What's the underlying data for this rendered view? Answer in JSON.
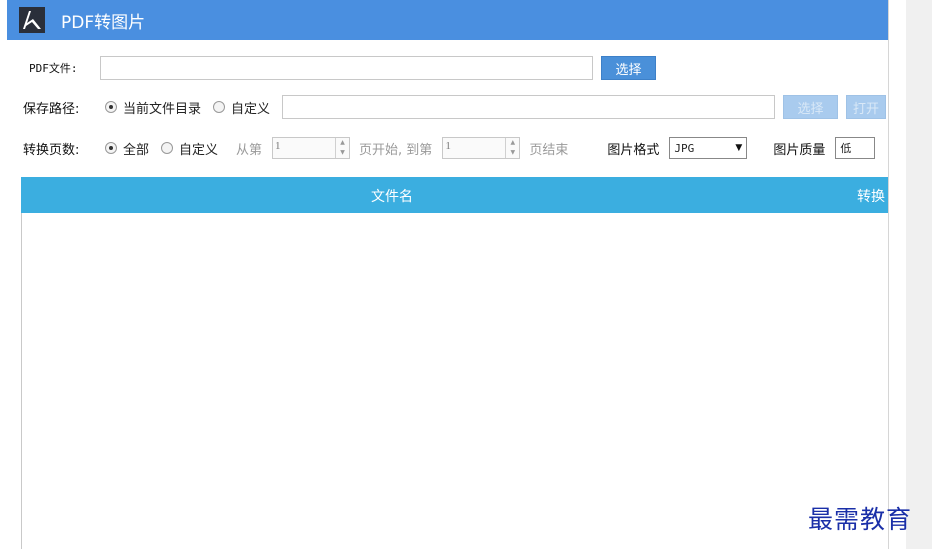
{
  "titlebar": {
    "title": "PDF转图片",
    "icon": "acrobat-logo-icon"
  },
  "pdf_file": {
    "label": "PDF文件:",
    "value": "",
    "select_label": "选择"
  },
  "save_path": {
    "label": "保存路径:",
    "option_current": "当前文件目录",
    "option_custom": "自定义",
    "value": "",
    "select_label": "选择",
    "open_label": "打开"
  },
  "pages": {
    "label": "转换页数:",
    "option_all": "全部",
    "option_custom": "自定义",
    "from_label": "从第",
    "from_value": "1",
    "start_label": "页开始, 到第",
    "to_value": "1",
    "end_label": "页结束"
  },
  "format": {
    "label": "图片格式",
    "value": "JPG"
  },
  "quality": {
    "label": "图片质量",
    "value": "低"
  },
  "table": {
    "col_filename": "文件名",
    "col_convert": "转换"
  },
  "watermark": "最需教育",
  "colors": {
    "titlebar": "#4a8fe0",
    "table_header": "#3baee0",
    "button": "#4a90d9"
  }
}
